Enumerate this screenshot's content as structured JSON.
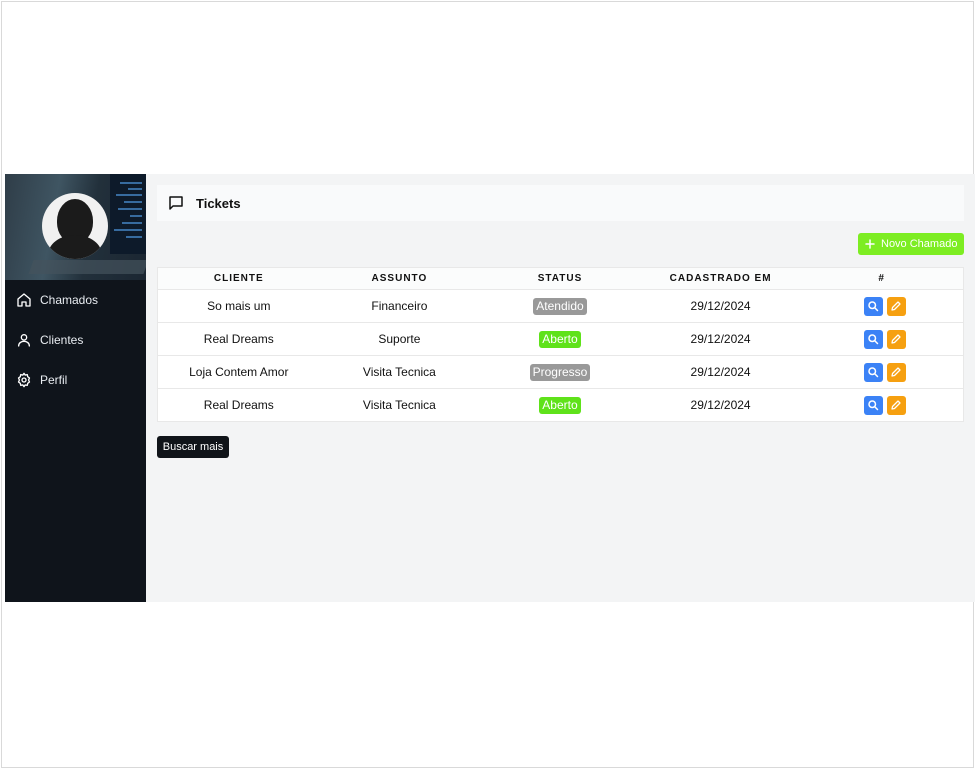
{
  "sidebar": {
    "items": [
      {
        "label": "Chamados",
        "icon": "home-icon"
      },
      {
        "label": "Clientes",
        "icon": "user-icon"
      },
      {
        "label": "Perfil",
        "icon": "gear-icon"
      }
    ]
  },
  "header": {
    "title": "Tickets",
    "icon": "message-icon"
  },
  "toolbar": {
    "new_ticket_label": "Novo Chamado",
    "load_more_label": "Buscar mais"
  },
  "table": {
    "columns": [
      "CLIENTE",
      "ASSUNTO",
      "STATUS",
      "CADASTRADO EM",
      "#"
    ],
    "rows": [
      {
        "cliente": "So mais um",
        "assunto": "Financeiro",
        "status": "Atendido",
        "cadastrado": "29/12/2024"
      },
      {
        "cliente": "Real Dreams",
        "assunto": "Suporte",
        "status": "Aberto",
        "cadastrado": "29/12/2024"
      },
      {
        "cliente": "Loja Contem Amor",
        "assunto": "Visita Tecnica",
        "status": "Progresso",
        "cadastrado": "29/12/2024"
      },
      {
        "cliente": "Real Dreams",
        "assunto": "Visita Tecnica",
        "status": "Aberto",
        "cadastrado": "29/12/2024"
      }
    ]
  },
  "colors": {
    "sidebar_bg": "#0f141b",
    "accent_green": "#7ded22",
    "status_open": "#5fe21a",
    "status_neutral": "#999999",
    "action_search": "#3b82f6",
    "action_edit": "#f6a010"
  }
}
